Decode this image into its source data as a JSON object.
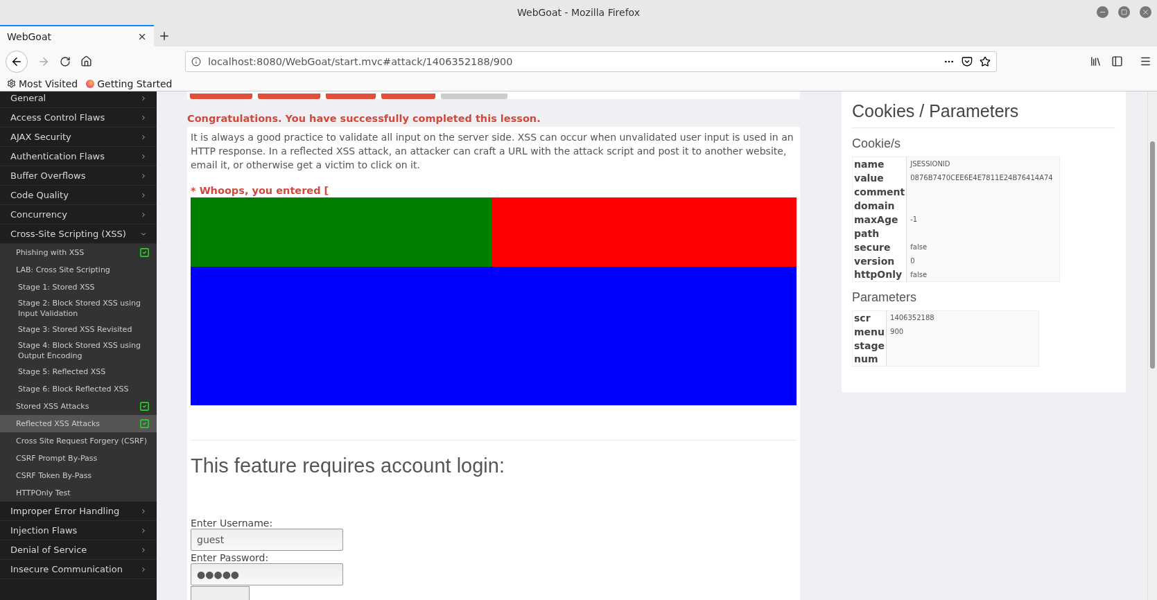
{
  "window": {
    "title": "WebGoat - Mozilla Firefox"
  },
  "tabs": [
    {
      "label": "WebGoat",
      "selected": true
    }
  ],
  "address_bar": {
    "url": "localhost:8080/WebGoat/start.mvc#attack/1406352188/900"
  },
  "bookmarks": [
    {
      "label": "Most Visited",
      "kind": "gear"
    },
    {
      "label": "Getting Started",
      "kind": "firefox"
    }
  ],
  "sidebar": {
    "items": [
      {
        "label": "General",
        "expanded": false
      },
      {
        "label": "Access Control Flaws",
        "expanded": false
      },
      {
        "label": "AJAX Security",
        "expanded": false
      },
      {
        "label": "Authentication Flaws",
        "expanded": false
      },
      {
        "label": "Buffer Overflows",
        "expanded": false
      },
      {
        "label": "Code Quality",
        "expanded": false
      },
      {
        "label": "Concurrency",
        "expanded": false
      },
      {
        "label": "Cross-Site Scripting (XSS)",
        "expanded": true,
        "children": [
          {
            "label": "Phishing with XSS",
            "completed": true,
            "selected": false
          },
          {
            "label": "LAB: Cross Site Scripting",
            "completed": false,
            "selected": false,
            "children": [
              {
                "label": "Stage 1: Stored XSS",
                "completed": false,
                "selected": false
              },
              {
                "label": "Stage 2: Block Stored XSS using Input Validation",
                "completed": false,
                "selected": false
              },
              {
                "label": "Stage 3: Stored XSS Revisited",
                "completed": false,
                "selected": false
              },
              {
                "label": "Stage 4: Block Stored XSS using Output Encoding",
                "completed": false,
                "selected": false
              },
              {
                "label": "Stage 5: Reflected XSS",
                "completed": false,
                "selected": false
              },
              {
                "label": "Stage 6: Block Reflected XSS",
                "completed": false,
                "selected": false
              }
            ]
          },
          {
            "label": "Stored XSS Attacks",
            "completed": true,
            "selected": false
          },
          {
            "label": "Reflected XSS Attacks",
            "completed": true,
            "selected": true
          },
          {
            "label": "Cross Site Request Forgery (CSRF)",
            "completed": false,
            "selected": false
          },
          {
            "label": "CSRF Prompt By-Pass",
            "completed": false,
            "selected": false
          },
          {
            "label": "CSRF Token By-Pass",
            "completed": false,
            "selected": false
          },
          {
            "label": "HTTPOnly Test",
            "completed": false,
            "selected": false
          }
        ]
      },
      {
        "label": "Improper Error Handling",
        "expanded": false
      },
      {
        "label": "Injection Flaws",
        "expanded": false
      },
      {
        "label": "Denial of Service",
        "expanded": false
      },
      {
        "label": "Insecure Communication",
        "expanded": false
      }
    ]
  },
  "lesson": {
    "success_message": "Congratulations. You have successfully completed this lesson.",
    "description": "It is always a good practice to validate all input on the server side. XSS can occur when unvalidated user input is used in an HTTP response. In a reflected XSS attack, an attacker can craft a URL with the attack script and post it to another website, email it, or otherwise get a victim to click on it.",
    "error_message": "* Whoops, you entered [",
    "login_heading": "This feature requires account login:",
    "username_label": "Enter Username:",
    "username": "guest",
    "password_label": "Enter Password:",
    "password": "●●●●●"
  },
  "cookies_panel": {
    "title": "Cookies / Parameters",
    "cookies_heading": "Cookie/s",
    "cookies": [
      {
        "key": "name",
        "value": "JSESSIONID"
      },
      {
        "key": "value",
        "value": "0876B7470CEE6E4E7811E24B76414A74"
      },
      {
        "key": "comment"
      },
      {
        "key": "domain"
      },
      {
        "key": "maxAge",
        "value": "-1"
      },
      {
        "key": "path"
      },
      {
        "key": "secure",
        "value": "false"
      },
      {
        "key": "version",
        "value": "0"
      },
      {
        "key": "httpOnly",
        "value": "false"
      }
    ],
    "parameters_heading": "Parameters",
    "parameters": [
      {
        "key": "scr",
        "value": "1406352188"
      },
      {
        "key": "menu",
        "value": "900"
      },
      {
        "key": "stage"
      },
      {
        "key": "num"
      }
    ]
  }
}
